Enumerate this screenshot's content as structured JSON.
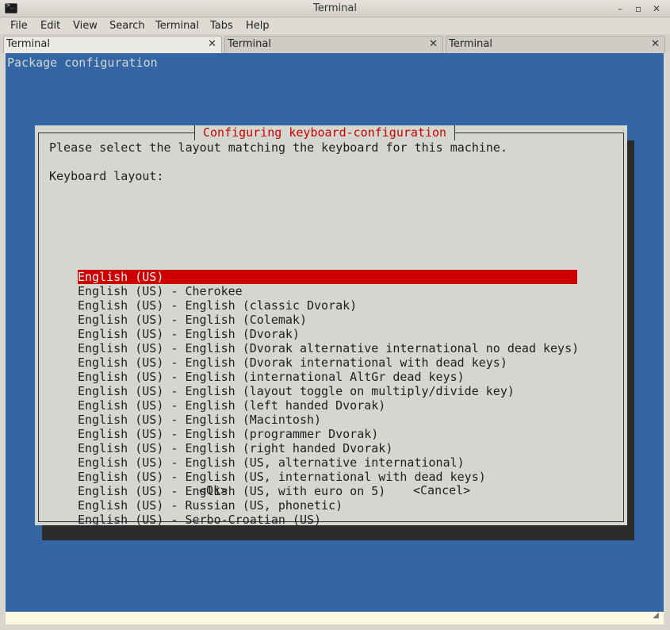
{
  "window": {
    "title": "Terminal"
  },
  "menu": [
    "File",
    "Edit",
    "View",
    "Search",
    "Terminal",
    "Tabs",
    "Help"
  ],
  "tabs": [
    {
      "label": "Terminal",
      "active": true
    },
    {
      "label": "Terminal",
      "active": false
    },
    {
      "label": "Terminal",
      "active": false
    }
  ],
  "terminal": {
    "header": "Package configuration",
    "dialog": {
      "title": "Configuring keyboard-configuration",
      "prompt": "Please select the layout matching the keyboard for this machine.",
      "field_label": "Keyboard layout:",
      "options": [
        "English (US)",
        "English (US) - Cherokee",
        "English (US) - English (classic Dvorak)",
        "English (US) - English (Colemak)",
        "English (US) - English (Dvorak)",
        "English (US) - English (Dvorak alternative international no dead keys)",
        "English (US) - English (Dvorak international with dead keys)",
        "English (US) - English (international AltGr dead keys)",
        "English (US) - English (layout toggle on multiply/divide key)",
        "English (US) - English (left handed Dvorak)",
        "English (US) - English (Macintosh)",
        "English (US) - English (programmer Dvorak)",
        "English (US) - English (right handed Dvorak)",
        "English (US) - English (US, alternative international)",
        "English (US) - English (US, international with dead keys)",
        "English (US) - English (US, with euro on 5)",
        "English (US) - Russian (US, phonetic)",
        "English (US) - Serbo-Croatian (US)"
      ],
      "selected_index": 0,
      "ok_label": "<Ok>",
      "cancel_label": "<Cancel>"
    }
  },
  "colors": {
    "terminal_bg": "#3465a4",
    "dialog_bg": "#d3d7cf",
    "selection": "#cc0000",
    "title_text": "#cc0000"
  }
}
